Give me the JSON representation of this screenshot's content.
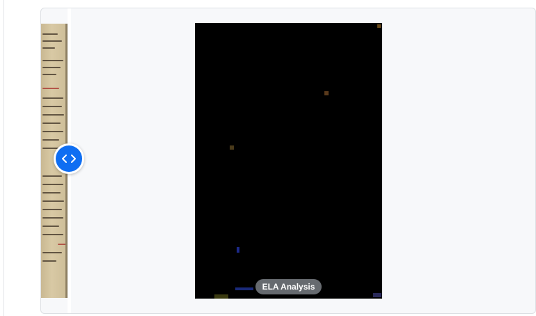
{
  "comparison": {
    "right_label": "ELA Analysis",
    "handle_icon": "chevron-left-right-icon",
    "accent_color": "#0f6ef2",
    "ela_background": "#000000"
  }
}
